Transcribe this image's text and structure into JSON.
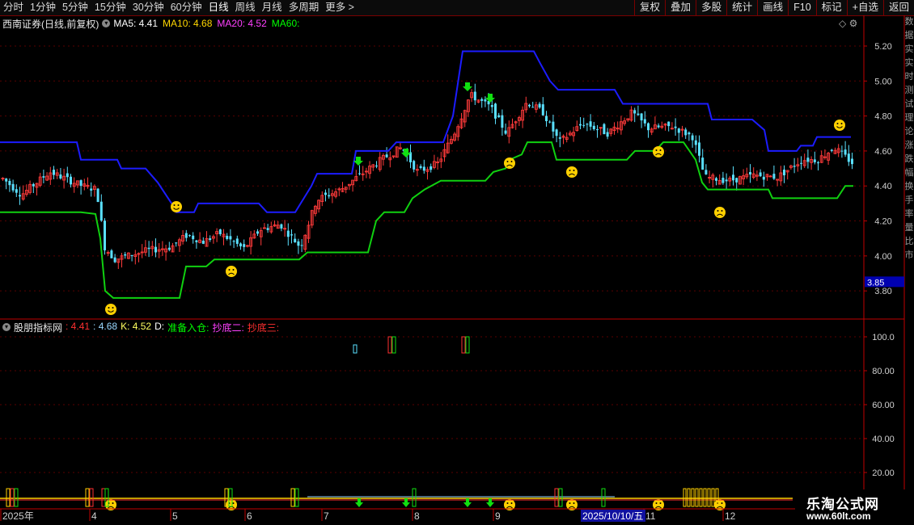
{
  "toolbar": {
    "timeframes": [
      "分时",
      "1分钟",
      "5分钟",
      "15分钟",
      "30分钟",
      "60分钟",
      "日线",
      "周线",
      "月线",
      "多周期",
      "更多 >"
    ],
    "active_timeframe": 6,
    "tools": [
      "复权",
      "叠加",
      "多股",
      "统计",
      "画线",
      "F10",
      "标记",
      "+自选",
      "返回"
    ]
  },
  "main_chart": {
    "title": "西南证券(日线,前复权)",
    "ma": [
      {
        "label": "MA5: 4.41",
        "color": "#ffffff"
      },
      {
        "label": "MA10: 4.68",
        "color": "#ffd700"
      },
      {
        "label": "MA20: 4.52",
        "color": "#ff40ff"
      },
      {
        "label": "MA60:",
        "color": "#00ff00"
      }
    ],
    "price_axis": [
      "5.20",
      "5.00",
      "4.80",
      "4.60",
      "4.40",
      "4.20",
      "4.00",
      "3.80"
    ],
    "price_marker": "3.85"
  },
  "indicator": {
    "name": "股朋指标网",
    "values": [
      {
        "label": ": 4.41",
        "color": "#ff3030"
      },
      {
        "label": ": 4.68",
        "color": "#9ad8ff"
      },
      {
        "label": "K: 4.52",
        "color": "#ffff60"
      },
      {
        "label": "D:",
        "color": "#ffffff"
      },
      {
        "label": "准备入仓:",
        "color": "#00ff00"
      },
      {
        "label": "抄底二:",
        "color": "#ff40ff"
      },
      {
        "label": "抄底三:",
        "color": "#ff3030"
      }
    ],
    "axis": [
      "100.0",
      "80.00",
      "60.00",
      "40.00",
      "20.00"
    ]
  },
  "date_axis": {
    "labels": [
      "2025年",
      "4",
      "5",
      "6",
      "7",
      "8",
      "9",
      "11",
      "12"
    ],
    "highlight": "2025/10/10/五"
  },
  "right_strip": [
    "数",
    "据",
    "实",
    "实",
    "时",
    "测",
    "试",
    "理",
    "论",
    "涨",
    "跌",
    "幅",
    "换",
    "手",
    "率",
    "量",
    "比",
    "市"
  ],
  "watermark": {
    "line1": "乐淘公式网",
    "line2": "www.60lt.com"
  },
  "colors": {
    "up": "#ff3a3a",
    "down": "#5ae0ff",
    "upper_band": "#1c1cff",
    "lower_band": "#10d010",
    "smiley": "#ffd000"
  }
}
